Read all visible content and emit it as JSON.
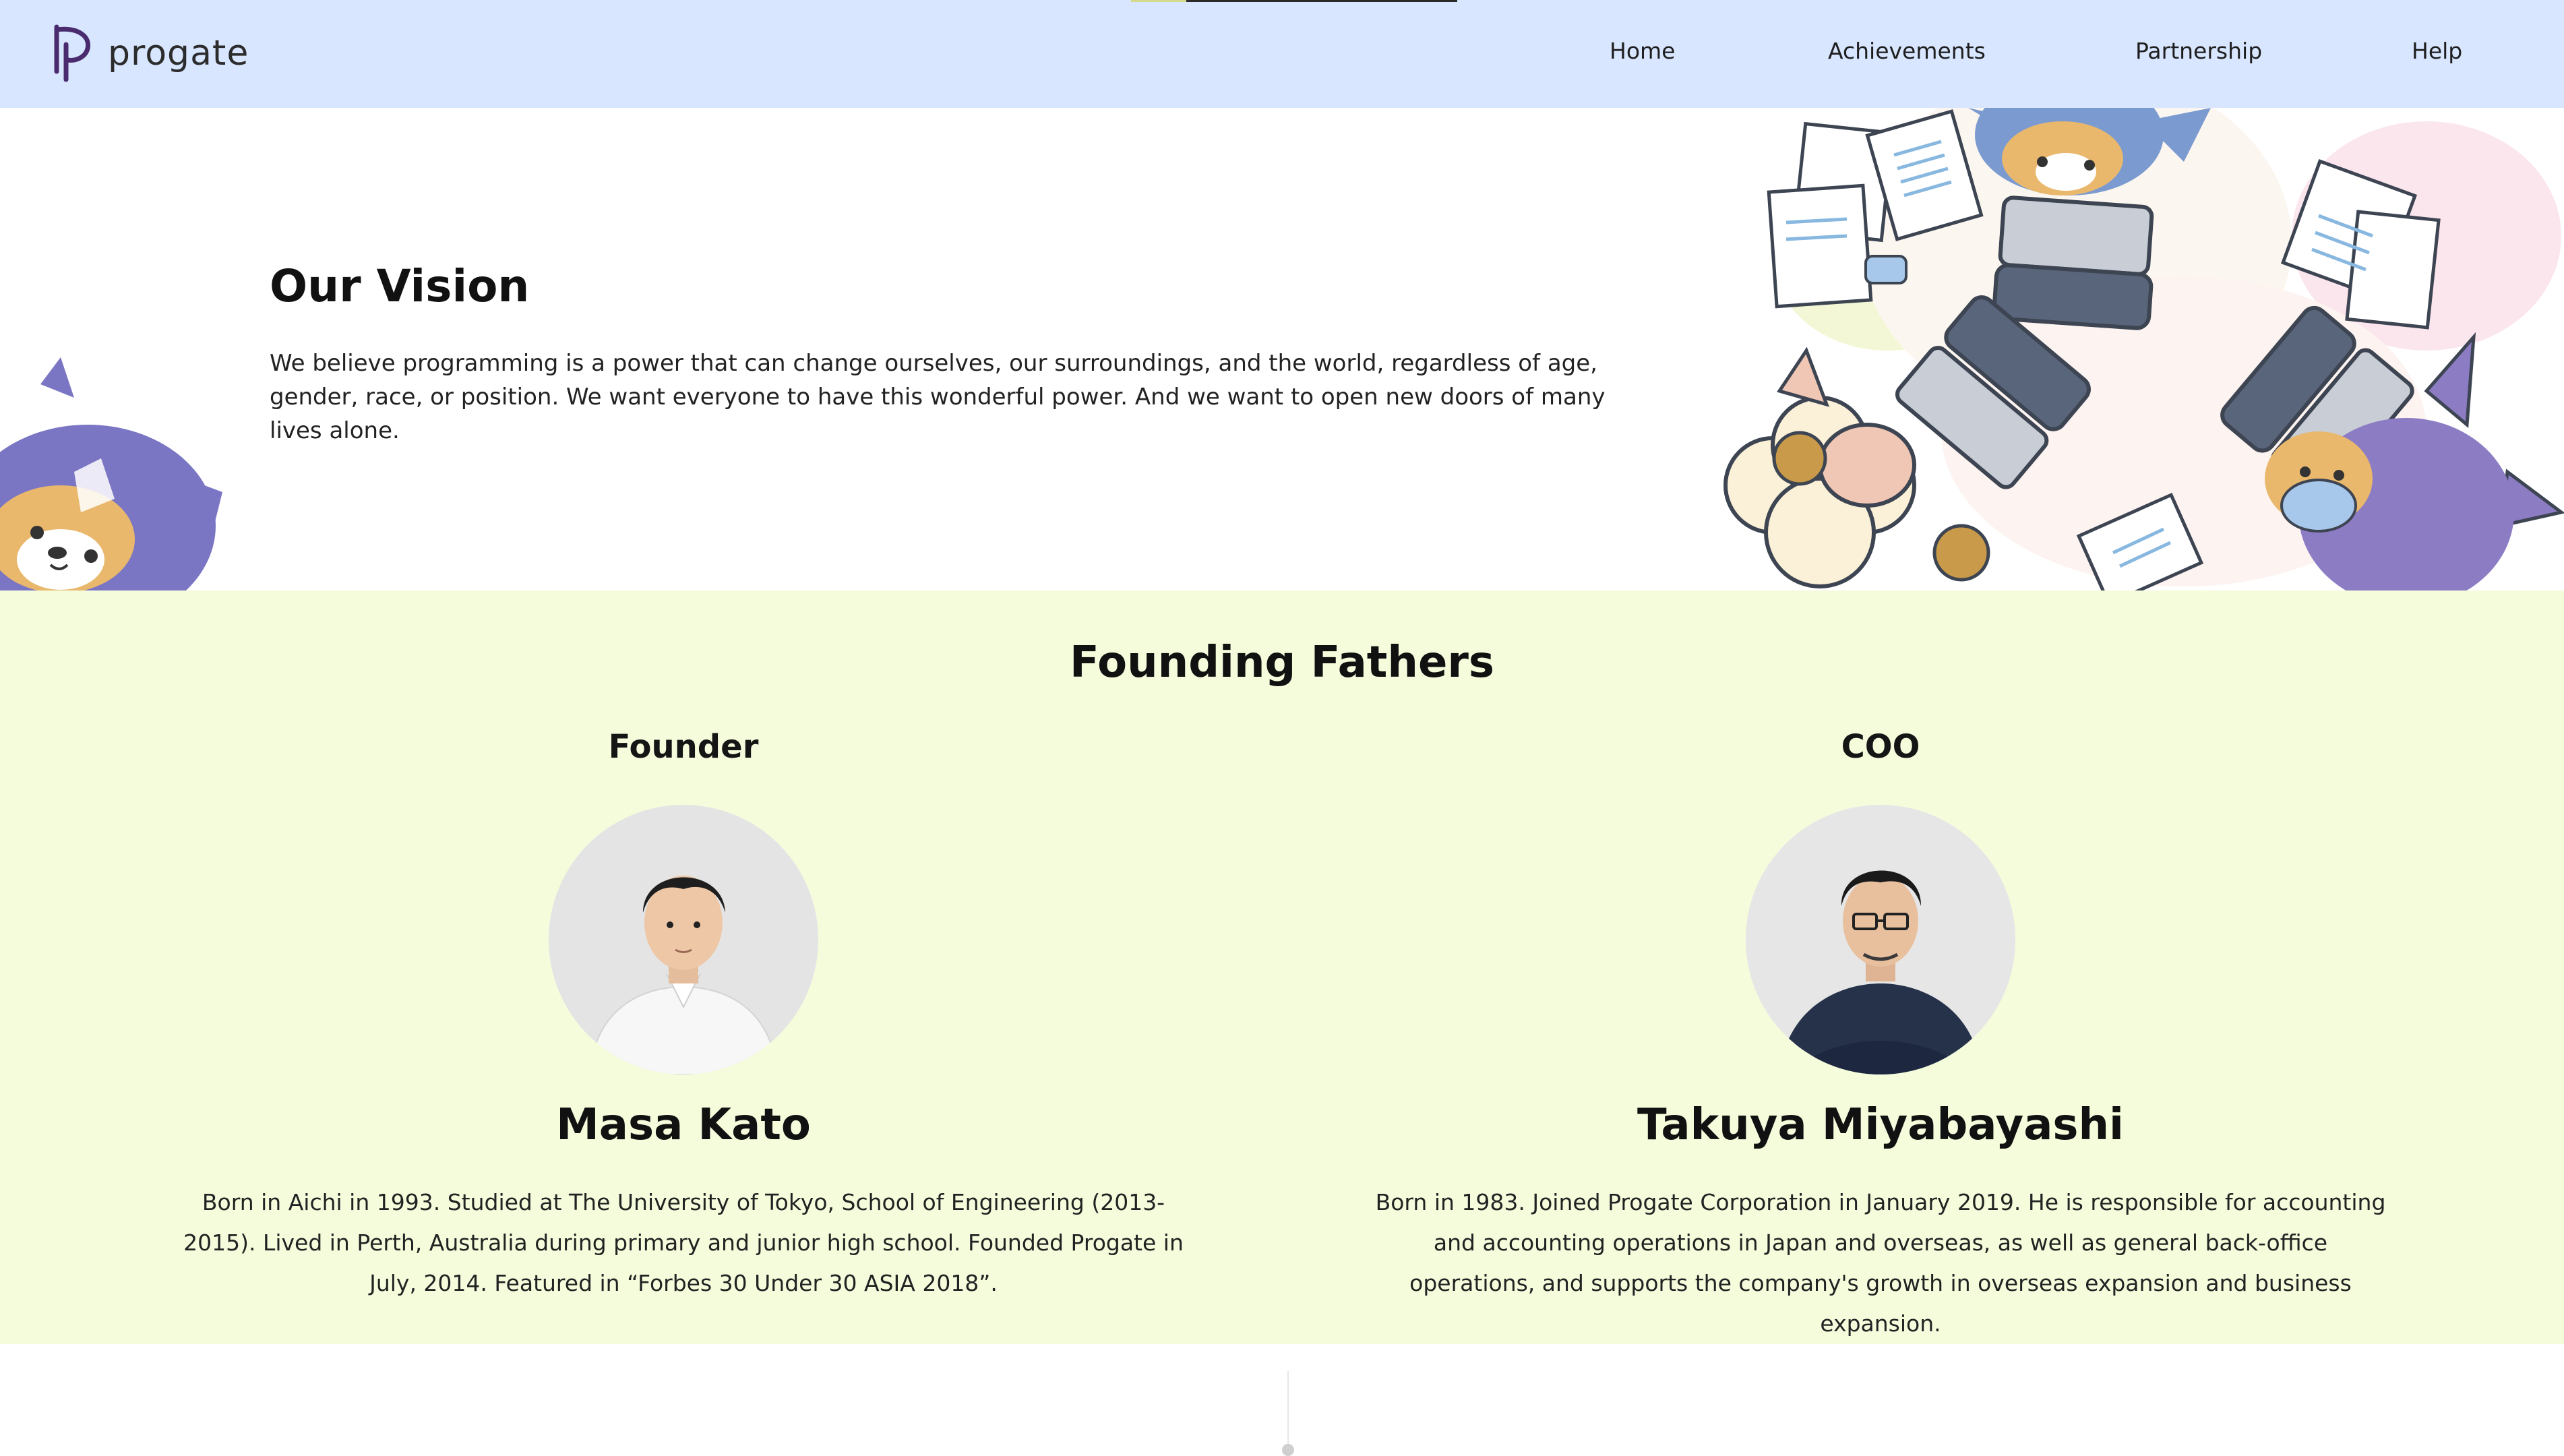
{
  "header": {
    "brand": "progate",
    "scroll_progress": 0.17,
    "nav": [
      {
        "label": "Home"
      },
      {
        "label": "Achievements"
      },
      {
        "label": "Partnership"
      },
      {
        "label": "Help"
      }
    ]
  },
  "vision": {
    "title": "Our Vision",
    "body": "We believe programming is a power that can change ourselves, our surroundings, and the world, regardless of age, gender, race, or position. We want everyone to have this wonderful power. And we want to open new doors of many lives alone."
  },
  "founders": {
    "title": "Founding Fathers",
    "people": [
      {
        "role": "Founder",
        "name": "Masa Kato",
        "bio": "Born in Aichi in 1993. Studied at The University of Tokyo, School of Engineering (2013-2015). Lived in Perth, Australia during primary and junior high school. Founded Progate in July, 2014. Featured in “Forbes 30 Under 30 ASIA 2018”."
      },
      {
        "role": "COO",
        "name": "Takuya Miyabayashi",
        "bio": "Born in 1983. Joined Progate Corporation in January 2019. He is responsible for accounting and accounting operations in Japan and overseas, as well as general back-office operations, and supports the company's growth in overseas expansion and business expansion."
      }
    ]
  },
  "colors": {
    "header_bg": "#d8e6ff",
    "founders_bg": "#f5fcdc",
    "brand_purple": "#4a2c6e"
  },
  "icons": {
    "logo": "progate-logo-icon",
    "mascot_left": "ninja-dog-mascot",
    "illustration_right": "team-coding-illustration"
  }
}
